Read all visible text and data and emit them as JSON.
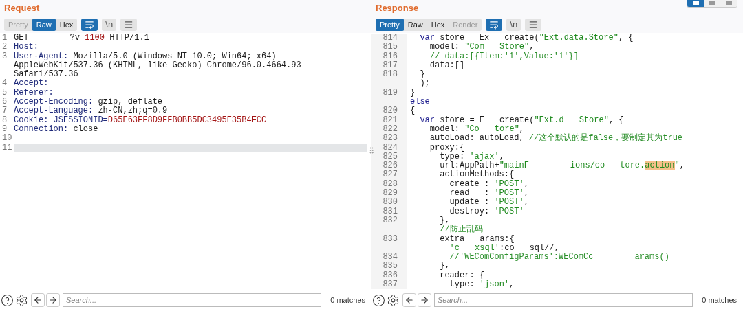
{
  "layout_buttons": [
    {
      "kind": "columns",
      "selected": true
    },
    {
      "kind": "rows",
      "selected": false
    },
    {
      "kind": "tabs",
      "selected": false
    }
  ],
  "panels": [
    {
      "title": "Request",
      "view_tabs": [
        {
          "label": "Pretty",
          "selected": false,
          "disabled": true
        },
        {
          "label": "Raw",
          "selected": true,
          "disabled": false
        },
        {
          "label": "Hex",
          "selected": false,
          "disabled": false
        }
      ],
      "toggles": [
        {
          "kind": "wrap",
          "on": true
        },
        {
          "kind": "newline",
          "label": "\\n",
          "on": false
        },
        {
          "kind": "menu",
          "on": false
        }
      ],
      "lines": [
        {
          "number": "1",
          "current": false,
          "rows": [
            [
              {
                "kind": "plain",
                "text": "GET"
              },
              {
                "kind": "wide_gap"
              },
              {
                "kind": "plain",
                "text": "?v="
              },
              {
                "kind": "number",
                "text": "1100"
              },
              {
                "kind": "plain",
                "text": " HTTP/1.1"
              }
            ]
          ]
        },
        {
          "number": "2",
          "current": false,
          "rows": [
            [
              {
                "kind": "header",
                "text": "Host:"
              }
            ]
          ]
        },
        {
          "number": "3",
          "current": false,
          "rows": [
            [
              {
                "kind": "header",
                "text": "User-Agent:"
              },
              {
                "kind": "plain",
                "text": " Mozilla/5.0 (Windows NT 10.0; Win64; x64)"
              }
            ],
            [
              {
                "kind": "plain",
                "text": "AppleWebKit/537.36 (KHTML, like Gecko) Chrome/96.0.4664.93"
              }
            ],
            [
              {
                "kind": "plain",
                "text": "Safari/537.36"
              }
            ]
          ]
        },
        {
          "number": "4",
          "current": false,
          "rows": [
            [
              {
                "kind": "header",
                "text": "Accept:"
              }
            ]
          ]
        },
        {
          "number": "5",
          "current": false,
          "rows": [
            [
              {
                "kind": "header",
                "text": "Referer:"
              }
            ]
          ]
        },
        {
          "number": "6",
          "current": false,
          "rows": [
            [
              {
                "kind": "header",
                "text": "Accept-Encoding:"
              },
              {
                "kind": "plain",
                "text": " gzip, deflate"
              }
            ]
          ]
        },
        {
          "number": "7",
          "current": false,
          "rows": [
            [
              {
                "kind": "header",
                "text": "Accept-Language:"
              },
              {
                "kind": "plain",
                "text": " zh-CN,zh;q=0.9"
              }
            ]
          ]
        },
        {
          "number": "8",
          "current": false,
          "rows": [
            [
              {
                "kind": "header",
                "text": "Cookie: JSESSIONID="
              },
              {
                "kind": "value",
                "text": "D65E63FF8D9FFB0BB5DC3495E35B4FCC"
              }
            ]
          ]
        },
        {
          "number": "9",
          "current": false,
          "rows": [
            [
              {
                "kind": "header",
                "text": "Connection:"
              },
              {
                "kind": "plain",
                "text": " close"
              }
            ]
          ]
        },
        {
          "number": "10",
          "current": false,
          "rows": [
            []
          ]
        },
        {
          "number": "11",
          "current": true,
          "rows": [
            []
          ]
        }
      ],
      "search": {
        "placeholder": "Search...",
        "matches": "0 matches"
      }
    },
    {
      "title": "Response",
      "view_tabs": [
        {
          "label": "Pretty",
          "selected": true,
          "disabled": false
        },
        {
          "label": "Raw",
          "selected": false,
          "disabled": false
        },
        {
          "label": "Hex",
          "selected": false,
          "disabled": false
        },
        {
          "label": "Render",
          "selected": false,
          "disabled": true
        }
      ],
      "toggles": [
        {
          "kind": "wrap",
          "on": true
        },
        {
          "kind": "newline",
          "label": "\\n",
          "on": false
        },
        {
          "kind": "menu",
          "on": false
        }
      ],
      "lines": [
        {
          "number": "814",
          "current": false,
          "rows": [
            [
              {
                "kind": "keyword",
                "text": "  var"
              },
              {
                "kind": "plain",
                "text": " store = Ex"
              },
              {
                "kind": "gap"
              },
              {
                "kind": "plain",
                "text": "create("
              },
              {
                "kind": "string",
                "text": "\"Ext.data.Store\""
              },
              {
                "kind": "plain",
                "text": ", {"
              }
            ]
          ]
        },
        {
          "number": "815",
          "current": false,
          "rows": [
            [
              {
                "kind": "plain",
                "text": "    model: "
              },
              {
                "kind": "string",
                "text": "\"Com"
              },
              {
                "kind": "gap"
              },
              {
                "kind": "string",
                "text": "Store\""
              },
              {
                "kind": "plain",
                "text": ","
              }
            ]
          ]
        },
        {
          "number": "816",
          "current": false,
          "rows": [
            [
              {
                "kind": "comment",
                "text": "    // data:[{Item:'1',Value:'1'}]"
              }
            ]
          ]
        },
        {
          "number": "817",
          "current": false,
          "rows": [
            [
              {
                "kind": "plain",
                "text": "    data:[]"
              }
            ]
          ]
        },
        {
          "number": "818",
          "current": false,
          "rows": [
            [
              {
                "kind": "plain",
                "text": "  }"
              }
            ],
            [
              {
                "kind": "plain",
                "text": "  );"
              }
            ]
          ]
        },
        {
          "number": "819",
          "current": false,
          "rows": [
            [
              {
                "kind": "plain",
                "text": "}"
              }
            ],
            [
              {
                "kind": "keyword",
                "text": "else"
              }
            ]
          ]
        },
        {
          "number": "820",
          "current": false,
          "rows": [
            [
              {
                "kind": "plain",
                "text": "{"
              }
            ]
          ]
        },
        {
          "number": "821",
          "current": false,
          "rows": [
            [
              {
                "kind": "keyword",
                "text": "  var"
              },
              {
                "kind": "plain",
                "text": " store = E"
              },
              {
                "kind": "gap"
              },
              {
                "kind": "plain",
                "text": "create("
              },
              {
                "kind": "string",
                "text": "\"Ext.d"
              },
              {
                "kind": "gap"
              },
              {
                "kind": "string",
                "text": "Store\""
              },
              {
                "kind": "plain",
                "text": ", {"
              }
            ]
          ]
        },
        {
          "number": "822",
          "current": false,
          "rows": [
            [
              {
                "kind": "plain",
                "text": "    model: "
              },
              {
                "kind": "string",
                "text": "\"Co"
              },
              {
                "kind": "gap"
              },
              {
                "kind": "string",
                "text": "tore\""
              },
              {
                "kind": "plain",
                "text": ","
              }
            ]
          ]
        },
        {
          "number": "823",
          "current": false,
          "rows": [
            [
              {
                "kind": "plain",
                "text": "    autoLoad: autoLoad, "
              },
              {
                "kind": "comment",
                "text": "//这个默认的是false，要制定其为true"
              }
            ]
          ]
        },
        {
          "number": "824",
          "current": false,
          "rows": [
            [
              {
                "kind": "plain",
                "text": "    proxy:{"
              }
            ]
          ]
        },
        {
          "number": "825",
          "current": false,
          "rows": [
            [
              {
                "kind": "plain",
                "text": "      type: "
              },
              {
                "kind": "string",
                "text": "'ajax'"
              },
              {
                "kind": "plain",
                "text": ","
              }
            ]
          ]
        },
        {
          "number": "826",
          "current": false,
          "rows": [
            [
              {
                "kind": "plain",
                "text": "      url:AppPath+"
              },
              {
                "kind": "string",
                "text": "\"mainF"
              },
              {
                "kind": "wide_gap"
              },
              {
                "kind": "string",
                "text": "ions/co"
              },
              {
                "kind": "gap"
              },
              {
                "kind": "string",
                "text": "tore."
              },
              {
                "kind": "highlight",
                "text": "action"
              },
              {
                "kind": "string",
                "text": "\""
              },
              {
                "kind": "plain",
                "text": ","
              }
            ]
          ]
        },
        {
          "number": "827",
          "current": false,
          "rows": [
            [
              {
                "kind": "plain",
                "text": "      actionMethods:{"
              }
            ]
          ]
        },
        {
          "number": "828",
          "current": false,
          "rows": [
            [
              {
                "kind": "plain",
                "text": "        create : "
              },
              {
                "kind": "string",
                "text": "'POST'"
              },
              {
                "kind": "plain",
                "text": ","
              }
            ]
          ]
        },
        {
          "number": "829",
          "current": false,
          "rows": [
            [
              {
                "kind": "plain",
                "text": "        read   : "
              },
              {
                "kind": "string",
                "text": "'POST'"
              },
              {
                "kind": "plain",
                "text": ","
              }
            ]
          ]
        },
        {
          "number": "830",
          "current": false,
          "rows": [
            [
              {
                "kind": "plain",
                "text": "        update : "
              },
              {
                "kind": "string",
                "text": "'POST'"
              },
              {
                "kind": "plain",
                "text": ","
              }
            ]
          ]
        },
        {
          "number": "831",
          "current": false,
          "rows": [
            [
              {
                "kind": "plain",
                "text": "        destroy: "
              },
              {
                "kind": "string",
                "text": "'POST'"
              }
            ]
          ]
        },
        {
          "number": "832",
          "current": false,
          "rows": [
            [
              {
                "kind": "plain",
                "text": "      },"
              }
            ],
            [
              {
                "kind": "comment",
                "text": "      //防止乱码"
              }
            ]
          ]
        },
        {
          "number": "833",
          "current": false,
          "rows": [
            [
              {
                "kind": "plain",
                "text": "      extra"
              },
              {
                "kind": "gap"
              },
              {
                "kind": "plain",
                "text": "arams:{"
              }
            ],
            [
              {
                "kind": "string",
                "text": "        'c"
              },
              {
                "kind": "gap"
              },
              {
                "kind": "string",
                "text": "xsql'"
              },
              {
                "kind": "plain",
                "text": ":co"
              },
              {
                "kind": "gap"
              },
              {
                "kind": "plain",
                "text": "sql//,"
              }
            ]
          ]
        },
        {
          "number": "834",
          "current": false,
          "rows": [
            [
              {
                "kind": "comment",
                "text": "        //'WEComConfigParams':WEComCc"
              },
              {
                "kind": "wide_gap"
              },
              {
                "kind": "comment",
                "text": "arams()"
              }
            ]
          ]
        },
        {
          "number": "835",
          "current": false,
          "rows": [
            [
              {
                "kind": "plain",
                "text": "      },"
              }
            ]
          ]
        },
        {
          "number": "836",
          "current": false,
          "rows": [
            [
              {
                "kind": "plain",
                "text": "      reader: {"
              }
            ]
          ]
        },
        {
          "number": "837",
          "current": false,
          "rows": [
            [
              {
                "kind": "plain",
                "text": "        type: "
              },
              {
                "kind": "string",
                "text": "'json'"
              },
              {
                "kind": "plain",
                "text": ","
              }
            ]
          ]
        }
      ],
      "search": {
        "placeholder": "Search...",
        "matches": "0 matches"
      }
    }
  ]
}
